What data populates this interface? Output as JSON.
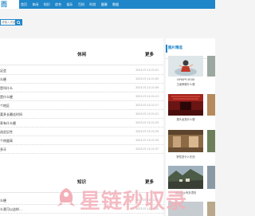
{
  "header": {
    "logo_text": "而",
    "nav": [
      "首页",
      "休闲",
      "知识",
      "综合",
      "娱乐",
      "百科",
      "时尚",
      "健康",
      "数据"
    ]
  },
  "search": {
    "placeholder": "请输入关键词"
  },
  "colors": {
    "brand": "#1f86c9",
    "watermark": "#f3b0b9"
  },
  "sections": [
    {
      "title": "休闲",
      "more": "更多",
      "items": [
        {
          "title": "足会",
          "date": "2023-07-10 21:01"
        },
        {
          "title": "么梗",
          "date": "2023-07-10 21:05"
        },
        {
          "title": "是叫什么",
          "date": "2023-07-10 21:09"
        },
        {
          "title": "是什么梗",
          "date": "2023-07-10 21:13"
        },
        {
          "title": "个地区",
          "date": "2023-07-10 21:17"
        },
        {
          "title": "喜多长最佳时间",
          "date": "2023-07-10 21:21"
        },
        {
          "title": "寿有什么梗",
          "date": "2023-07-10 21:25"
        },
        {
          "title": "选定反性",
          "date": "2023-07-10 21:29"
        },
        {
          "title": "个热量高",
          "date": "2023-07-10 21:33"
        },
        {
          "title": "多牙",
          "date": "2023-07-10 21:37"
        }
      ]
    },
    {
      "title": "知识",
      "more": "更多",
      "items": [
        {
          "title": "么梗",
          "date": "2023-07-10 21:41"
        },
        {
          "title": "么我可以这样...",
          "date": "2023-07-10 21:45"
        }
      ]
    }
  ],
  "sidebar": {
    "title": "图片精选",
    "pictures": [
      {
        "caption": "VIP68气·8F.88",
        "sub": "王者荣耀什么梗"
      },
      {
        "caption": ""
      },
      {
        "caption": "蛋头龙是什么梗"
      },
      {
        "caption": ""
      },
      {
        "caption": "野性是什么东西"
      },
      {
        "caption": ""
      },
      {
        "caption": "你的家乡有多漂亮"
      },
      {
        "caption": ""
      }
    ]
  },
  "watermark": {
    "text": "星链秒収录"
  }
}
